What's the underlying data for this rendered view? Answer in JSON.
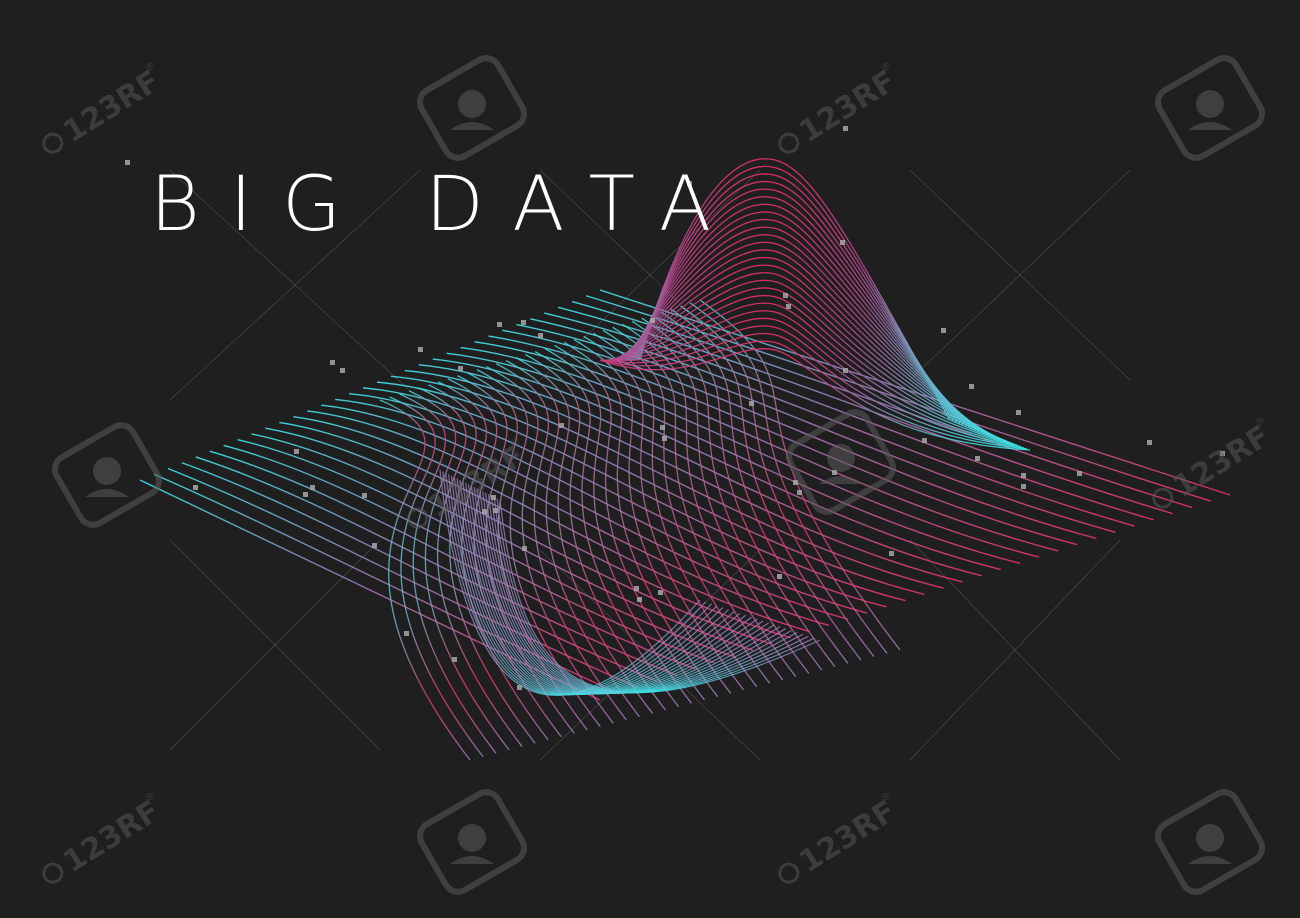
{
  "title": "BIG DATA",
  "watermark": {
    "text": "123RF",
    "mark": "®"
  },
  "colors": {
    "background": "#1f1f1f",
    "title": "#ffffff",
    "wave_cyan": "#3ee6e8",
    "wave_magenta": "#e8316e",
    "wave_violet": "#9a7fb8",
    "grid_lines": "#6a6a6a",
    "particles": "#a8a8a8",
    "watermark": "#5a5a5a"
  },
  "icons": [
    "camera-watermark-icon",
    "123rf-logo-icon"
  ]
}
